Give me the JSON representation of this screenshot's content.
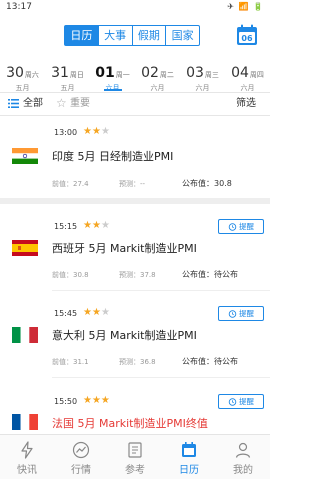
{
  "status": {
    "time": "13:17",
    "icons": "✈ 📶 🔋"
  },
  "header": {
    "tabs": [
      {
        "label": "日历",
        "active": true
      },
      {
        "label": "大事",
        "active": false
      },
      {
        "label": "假期",
        "active": false
      },
      {
        "label": "国家",
        "active": false
      }
    ],
    "calendar_icon_day": "06"
  },
  "dates": [
    {
      "day": "30",
      "weekday": "周六",
      "month": "五月",
      "active": false
    },
    {
      "day": "31",
      "weekday": "周日",
      "month": "五月",
      "active": false
    },
    {
      "day": "01",
      "weekday": "周一",
      "month": "六月",
      "active": true
    },
    {
      "day": "02",
      "weekday": "周二",
      "month": "六月",
      "active": false
    },
    {
      "day": "03",
      "weekday": "周三",
      "month": "六月",
      "active": false
    },
    {
      "day": "04",
      "weekday": "周四",
      "month": "六月",
      "active": false
    }
  ],
  "filters": {
    "all": "全部",
    "important": "重要",
    "filter": "筛选"
  },
  "events": [
    {
      "time": "13:00",
      "stars": 2,
      "flag": "india",
      "title": "印度 5月 日经制造业PMI",
      "prev": "前值：27.4",
      "forecast": "预测：--",
      "published": "公布值：30.8",
      "remind": null,
      "title_color": "#222222"
    },
    {
      "time": "15:15",
      "stars": 2,
      "flag": "spain",
      "title": "西班牙 5月 Markit制造业PMI",
      "prev": "前值：30.8",
      "forecast": "预测：37.8",
      "published": "公布值：待公布",
      "remind": "提醒",
      "title_color": "#222222"
    },
    {
      "time": "15:45",
      "stars": 2,
      "flag": "italy",
      "title": "意大利 5月 Markit制造业PMI",
      "prev": "前值：31.1",
      "forecast": "预测：36.8",
      "published": "公布值：待公布",
      "remind": "提醒",
      "title_color": "#222222"
    },
    {
      "time": "15:50",
      "stars": 3,
      "flag": "france",
      "title": "法国 5月 Markit制造业PMI终值",
      "remind": "提醒",
      "title_color": "#e53935"
    }
  ],
  "tabbar": [
    {
      "label": "快讯",
      "icon": "flash-icon",
      "active": false
    },
    {
      "label": "行情",
      "icon": "trend-icon",
      "active": false
    },
    {
      "label": "参考",
      "icon": "book-icon",
      "active": false
    },
    {
      "label": "日历",
      "icon": "calendar-icon",
      "active": true
    },
    {
      "label": "我的",
      "icon": "user-icon",
      "active": false
    }
  ],
  "colors": {
    "accent": "#1e88e5",
    "star": "#f5a623",
    "alert_title": "#e53935"
  }
}
